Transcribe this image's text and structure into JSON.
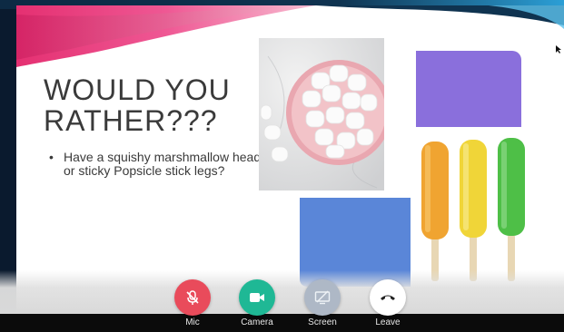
{
  "slide": {
    "title_line1": "WOULD YOU",
    "title_line2": "RATHER???",
    "bullet_symbol": "•",
    "bullet_text": "Have a squishy marshmallow head or sticky Popsicle stick legs?"
  },
  "colors": {
    "purple_block": "#8a6fdc",
    "blue_block": "#5a86d8",
    "mic_button": "#e94b5b",
    "camera_button": "#1fb895",
    "screen_button": "#aeb8c6",
    "leave_button": "#ffffff",
    "popsicle_orange": "#f0a431",
    "popsicle_yellow": "#f0d538",
    "popsicle_green": "#4ebf47"
  },
  "controls": {
    "mic": {
      "label": "Mic",
      "icon": "mic-off-icon",
      "state": "muted"
    },
    "camera": {
      "label": "Camera",
      "icon": "video-camera-icon"
    },
    "screen": {
      "label": "Screen",
      "icon": "screen-share-off-icon"
    },
    "leave": {
      "label": "Leave",
      "icon": "phone-hangup-icon"
    }
  }
}
